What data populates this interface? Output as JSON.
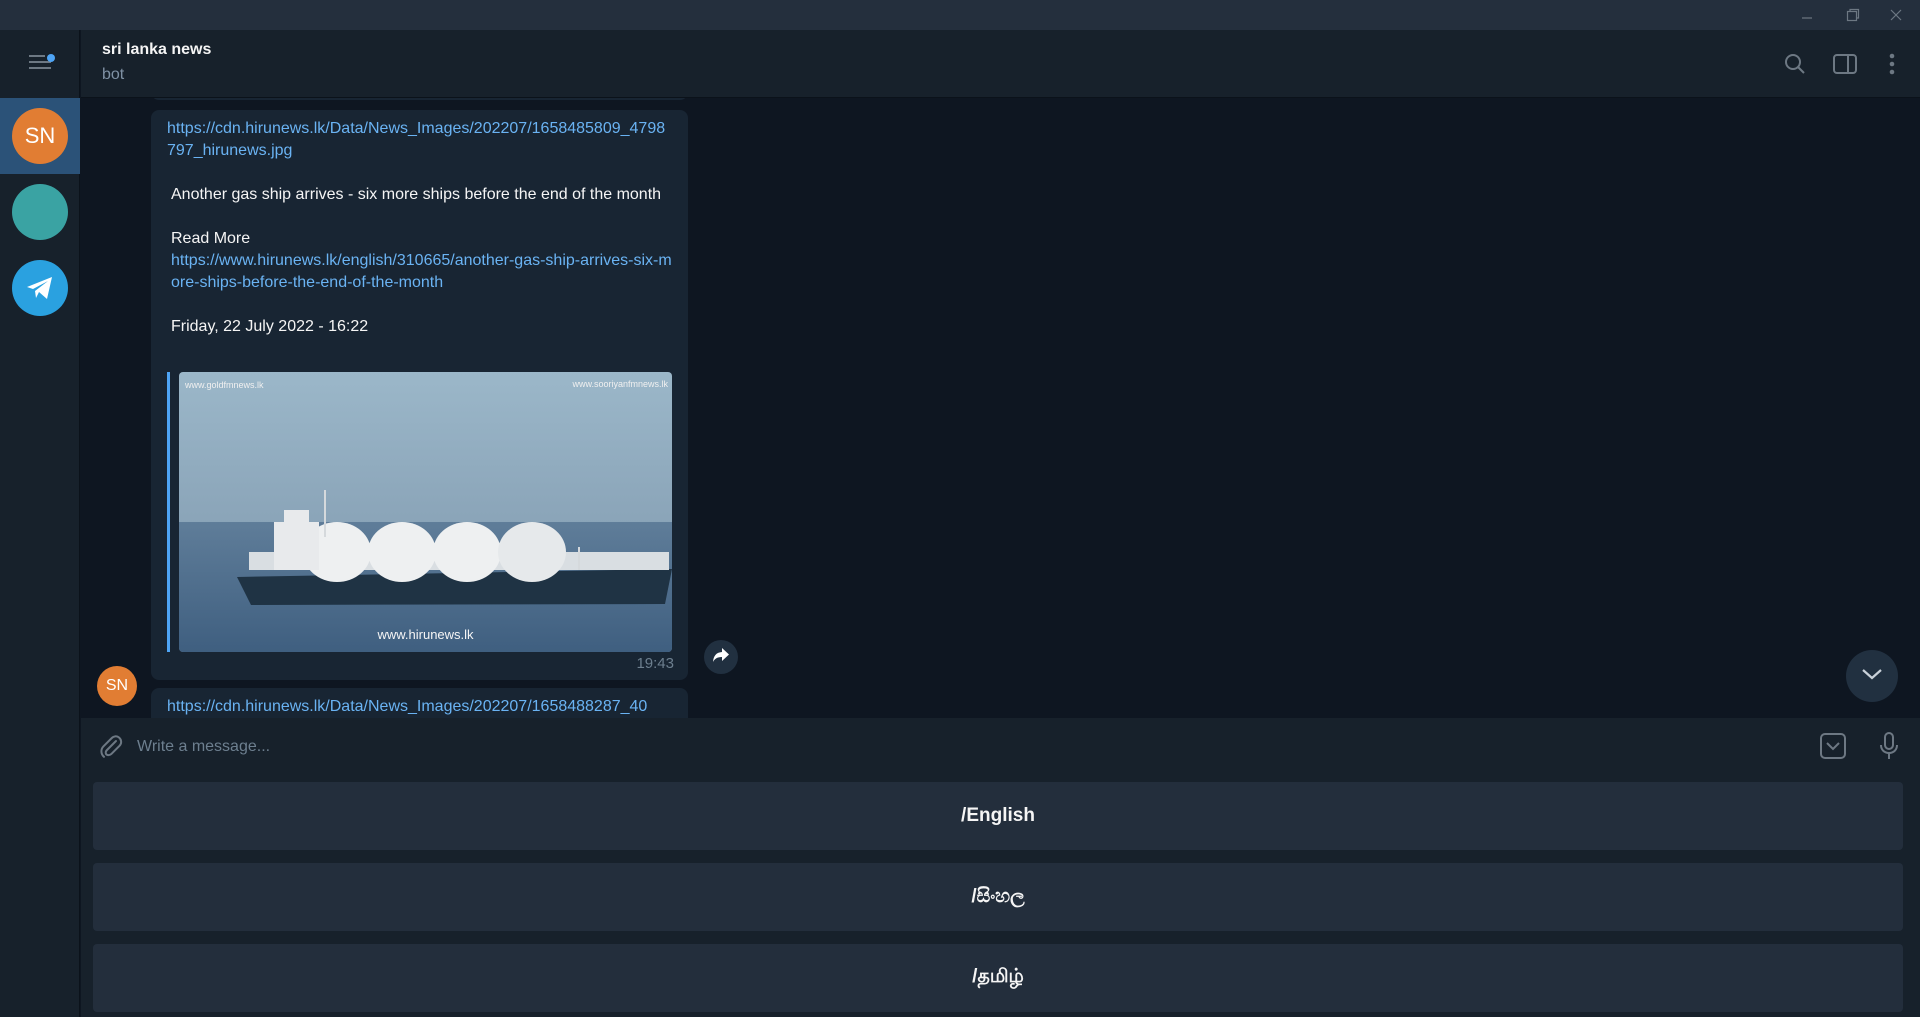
{
  "window": {
    "minimize_icon": "minimize-icon",
    "restore_icon": "restore-icon",
    "close_icon": "close-icon"
  },
  "sidebar": {
    "menu_icon": "hamburger-menu-icon",
    "chats": [
      {
        "initials": "SN",
        "color": "#e17d33",
        "active": true
      },
      {
        "initials": "",
        "color": "#3aa3a3",
        "active": false
      },
      {
        "initials": "",
        "color": "#2aa1e0",
        "icon": "telegram-icon",
        "active": false
      }
    ]
  },
  "header": {
    "title": "sri lanka news",
    "status": "bot",
    "icons": [
      "search-icon",
      "sidebar-toggle-icon",
      "more-vertical-icon"
    ]
  },
  "messages": [
    {
      "image_link": "https://cdn.hirunews.lk/Data/News_Images/202207/1658485809_4798797_hirunews.jpg",
      "headline": "Another gas ship arrives - six more ships before the end of the month",
      "read_more_label": "Read More",
      "article_link": "https://www.hirunews.lk/english/310665/another-gas-ship-arrives-six-more-ships-before-the-end-of-the-month",
      "date": "Friday, 22 July 2022 - 16:22",
      "image": {
        "watermark_left": "www.goldfmnews.lk",
        "watermark_right": "www.sooriyanfmnews.lk",
        "watermark_bottom": "www.hirunews.lk"
      },
      "time": "19:43"
    },
    {
      "sender_initials": "SN",
      "image_link": "https://cdn.hirunews.lk/Data/News_Images/202207/1658488287_40"
    }
  ],
  "composer": {
    "placeholder": "Write a message...",
    "attach_icon": "paperclip-icon",
    "keyboard_icon": "bot-keyboard-icon",
    "mic_icon": "microphone-icon"
  },
  "keyboard": {
    "buttons": [
      "/English",
      "/සිංහල",
      "/தமிழ்"
    ]
  },
  "colors": {
    "accent": "#4ea4f5",
    "link": "#6ab3f3",
    "background": "#0e1621",
    "panel": "#17212b",
    "bubble": "#182533"
  }
}
